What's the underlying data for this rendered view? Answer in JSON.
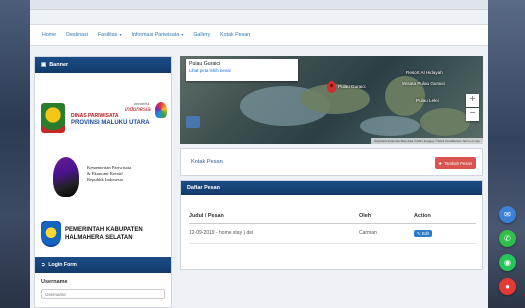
{
  "nav": {
    "items": [
      {
        "label": "Home"
      },
      {
        "label": "Destinasi"
      },
      {
        "label": "Fasilitas",
        "dropdown": true
      },
      {
        "label": "Informasi Pariwisata",
        "dropdown": true
      },
      {
        "label": "Gallery"
      },
      {
        "label": "Kotak Pesan"
      }
    ]
  },
  "sidebar": {
    "banner_title": "Banner",
    "logo1": {
      "line1": "DINAS PARIWISATA",
      "line2": "PROVINSI MALUKU UTARA",
      "wonderful": "wonderful",
      "indonesia": "indonesia"
    },
    "logo2": {
      "line1": "Kementerian Pariwisata",
      "line2": "& Ekonomi Kreatif",
      "line3": "Republik Indonesia"
    },
    "logo3": {
      "line1": "PEMERINTAH KABUPATEN",
      "line2": "HALMAHERA SELATAN"
    },
    "login": {
      "title": "Login Form",
      "username_label": "Username",
      "username_placeholder": "Username"
    }
  },
  "map": {
    "place_title": "Pulau Guraici",
    "bigger_map_link": "Lihat peta lebih besar",
    "pin_label": "Pulau Guraici",
    "labels": [
      "Resort Al Hidayah",
      "Wisata Pulau Guraici",
      "Pulau Lelei"
    ],
    "copyright": "Keyboard shortcuts  Map data ©2021  Imagery ©2021 TerraMetrics  Terms of Use"
  },
  "kotak_pesan": {
    "title": "Kotak Pesan",
    "add_button": "Tambah Pesan"
  },
  "daftar_pesan": {
    "title": "Daftar Pesan",
    "columns": [
      "Judul / Pesan",
      "Oleh",
      "Action"
    ],
    "rows": [
      {
        "judul": "12-09-2019 - home stay ) dei",
        "oleh": "Carman",
        "action": "Edit"
      }
    ]
  },
  "colors": {
    "panel_header": "#1c4d88",
    "link": "#337ab7",
    "add_button": "#d9534f",
    "edit_button": "#2a7dc9"
  },
  "float_buttons": [
    {
      "icon": "envelope-icon",
      "color": "#3b82d6"
    },
    {
      "icon": "phone-icon",
      "color": "#2fbf4a"
    },
    {
      "icon": "whatsapp-icon",
      "color": "#25c55a"
    },
    {
      "icon": "chat-icon",
      "color": "#e53935"
    }
  ]
}
